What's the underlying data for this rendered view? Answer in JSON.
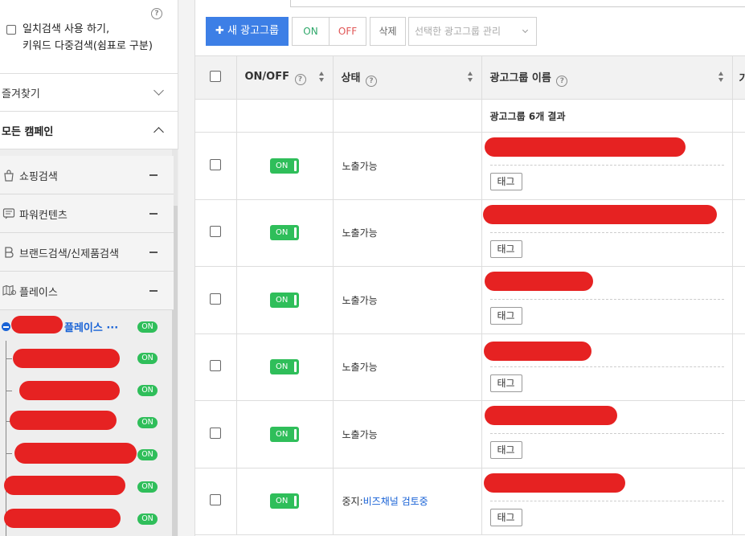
{
  "sidebar": {
    "exact_search": {
      "line1": "일치검색 사용 하기,",
      "line2": "키워드 다중검색(쉼표로 구분)",
      "help": "?"
    },
    "favorites_label": "즐겨찾기",
    "all_campaigns_label": "모든 캠페인",
    "campaign_types": [
      {
        "label": "쇼핑검색",
        "icon": "shopping-bag-icon"
      },
      {
        "label": "파워컨텐츠",
        "icon": "content-icon"
      },
      {
        "label": "브랜드검색/신제품검색",
        "icon": "brand-b-icon"
      },
      {
        "label": "플레이스",
        "icon": "place-map-icon"
      }
    ],
    "selected_campaign_suffix": "플레이스 ···",
    "on_label": "ON"
  },
  "toolbar": {
    "new_group_label": "새 광고그룹",
    "on_label": "ON",
    "off_label": "OFF",
    "delete_label": "삭제",
    "manage_label": "선택한 광고그룹 관리"
  },
  "table": {
    "headers": {
      "onoff": "ON/OFF",
      "status": "상태",
      "name": "광고그룹 이름",
      "next": "가"
    },
    "result_text": "광고그룹 6개 결과",
    "tag_label": "태그",
    "rows": [
      {
        "toggle": "ON",
        "status": "노출가능",
        "status_link": ""
      },
      {
        "toggle": "ON",
        "status": "노출가능",
        "status_link": ""
      },
      {
        "toggle": "ON",
        "status": "노출가능",
        "status_link": ""
      },
      {
        "toggle": "ON",
        "status": "노출가능",
        "status_link": ""
      },
      {
        "toggle": "ON",
        "status": "노출가능",
        "status_link": ""
      },
      {
        "toggle": "ON",
        "status": "중지:",
        "status_link": "비즈채널 검토중"
      }
    ]
  },
  "colors": {
    "primary": "#3d7fe6",
    "on_green": "#2fbe5a",
    "redaction": "#e62222",
    "link_blue": "#1862d6"
  }
}
